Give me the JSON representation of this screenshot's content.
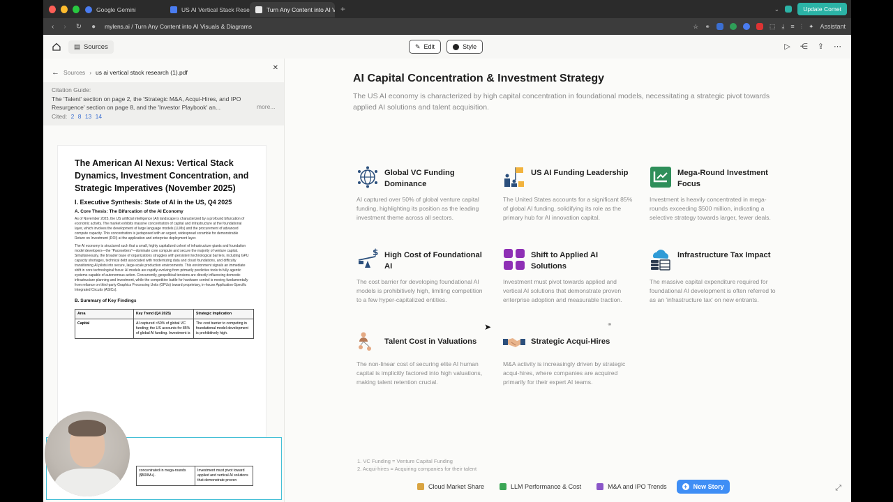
{
  "browser": {
    "tabs": [
      {
        "label": "Google Gemini",
        "active": false,
        "icon": "gemini-icon",
        "color": "#4a7cf0"
      },
      {
        "label": "US AI Vertical Stack Research",
        "active": false,
        "icon": "doc-icon",
        "color": "#4a7cf0"
      },
      {
        "label": "Turn Any Content into AI Visuals",
        "active": true,
        "icon": "mylens-icon",
        "color": "#e8e8e8"
      }
    ],
    "update_label": "Update Comet",
    "url": "mylens.ai / Turn Any Content into AI Visuals & Diagrams",
    "assistant_label": "Assistant"
  },
  "toolbar": {
    "sources_label": "Sources",
    "edit_label": "Edit",
    "style_label": "Style"
  },
  "left": {
    "breadcrumb_root": "Sources",
    "breadcrumb_file": "us ai vertical stack research (1).pdf",
    "citation_label": "Citation Guide:",
    "citation_text": "The 'Talent' section on page 2, the 'Strategic M&A, Acqui-Hires, and IPO Resurgence' section on page 8, and the 'Investor Playbook' an...",
    "more_label": "more...",
    "cited_label": "Cited:",
    "cited_pages": [
      "2",
      "8",
      "13",
      "14"
    ],
    "doc": {
      "title": "The American AI Nexus: Vertical Stack Dynamics, Investment Concentration, and Strategic Imperatives (November 2025)",
      "h2": "I. Executive Synthesis: State of AI in the US, Q4 2025",
      "h3a": "A. Core Thesis: The Bifurcation of the AI Economy",
      "p1": "As of November 2025, the US artificial intelligence (AI) landscape is characterized by a profound bifurcation of economic activity. The market exhibits massive concentration of capital and infrastructure at the foundational layer, which involves the development of large language models (LLMs) and the procurement of advanced compute capacity. This concentration is juxtaposed with an urgent, widespread scramble for demonstrable Return on Investment (ROI) at the application and enterprise deployment layer.",
      "p2": "The AI economy is structured such that a small, highly capitalized cohort of infrastructure giants and foundation model developers—the \"Pacesetters\"—dominate core compute and secure the majority of venture capital. Simultaneously, the broader base of organizations struggles with persistent technological barriers, including GPU capacity shortages, technical debt associated with modernizing data and cloud foundations, and difficulty transitioning AI pilots into secure, large-scale production environments. This environment signals an immediate shift in core technological focus: AI models are rapidly evolving from primarily predictive tools to fully agentic systems capable of autonomous action. Concurrently, geopolitical tensions are directly influencing domestic infrastructure planning and investment, while the competitive battle for hardware control is moving fundamentally from reliance on third-party Graphics Processing Units (GPUs) toward proprietary, in-house Application-Specific Integrated Circuits (ASICs).",
      "h3b": "B. Summary of Key Findings",
      "table_headers": [
        "Area",
        "Key Trend (Q4 2025)",
        "Strategic Implication"
      ],
      "table_row": [
        "Capital",
        "AI captured >50% of global VC funding; the US accounts for 85% of global AI funding. Investment is",
        "The cost barrier to competing in foundational model development is prohibitively high."
      ],
      "table2_row": [
        "concentrated in mega-rounds ($500M+).",
        "Investment must pivot toward applied and vertical AI solutions that demonstrate proven"
      ]
    }
  },
  "main": {
    "title": "AI Capital Concentration & Investment Strategy",
    "subtitle": "The US AI economy is characterized by high capital concentration in foundational models, necessitating a strategic pivot towards applied AI solutions and talent acquisition.",
    "cards": [
      {
        "title": "Global VC Funding Dominance",
        "desc": "AI captured over 50% of global venture capital funding, highlighting its position as the leading investment theme across all sectors.",
        "icon": "globe-network-icon"
      },
      {
        "title": "US AI Funding Leadership",
        "desc": "The United States accounts for a significant 85% of global AI funding, solidifying its role as the primary hub for AI innovation capital.",
        "icon": "podium-flag-icon"
      },
      {
        "title": "Mega-Round Investment Focus",
        "desc": "Investment is heavily concentrated in mega-rounds exceeding $500 million, indicating a selective strategy towards larger, fewer deals.",
        "icon": "growth-chart-icon"
      },
      {
        "title": "High Cost of Foundational AI",
        "desc": "The cost barrier for developing foundational AI models is prohibitively high, limiting competition to a few hyper-capitalized entities.",
        "icon": "balance-dollar-icon"
      },
      {
        "title": "Shift to Applied AI Solutions",
        "desc": "Investment must pivot towards applied and vertical AI solutions that demonstrate proven enterprise adoption and measurable traction.",
        "icon": "app-grid-icon"
      },
      {
        "title": "Infrastructure Tax Impact",
        "desc": "The massive capital expenditure required for foundational AI development is often referred to as an 'infrastructure tax' on new entrants.",
        "icon": "cloud-server-icon"
      },
      {
        "title": "Talent Cost in Valuations",
        "desc": "The non-linear cost of securing elite AI human capital is implicitly factored into high valuations, making talent retention crucial.",
        "icon": "people-network-icon"
      },
      {
        "title": "Strategic Acqui-Hires",
        "desc": "M&A activity is increasingly driven by strategic acqui-hires, where companies are acquired primarily for their expert AI teams.",
        "icon": "handshake-icon"
      }
    ],
    "footnotes": [
      "1. VC Funding = Venture Capital Funding",
      "2. Acqui-hires = Acquiring companies for their talent"
    ],
    "bottom_tabs": [
      {
        "label": "Cloud Market Share",
        "color": "#d9a441"
      },
      {
        "label": "LLM Performance & Cost",
        "color": "#3aa655"
      },
      {
        "label": "M&A and IPO Trends",
        "color": "#8a56c8"
      }
    ],
    "new_story_label": "New Story"
  }
}
